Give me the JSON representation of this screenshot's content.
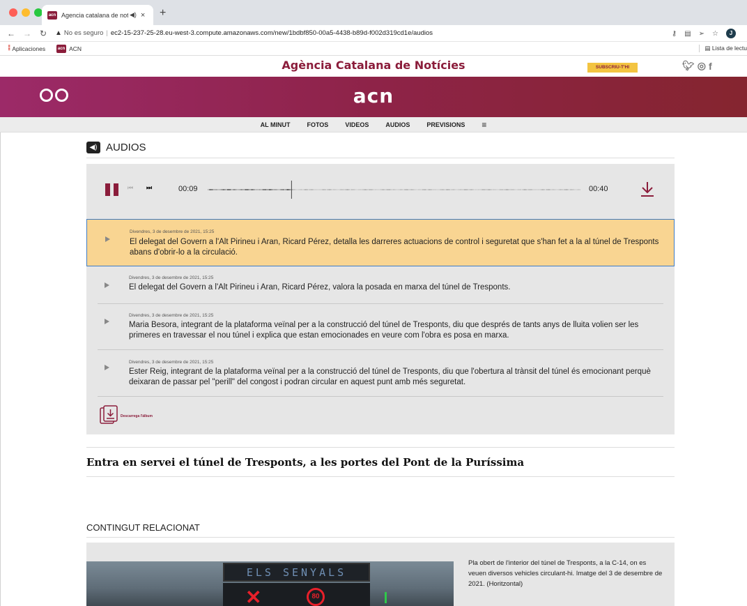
{
  "browser": {
    "tab_title": "Agencia catalana de notícies",
    "tab_favicon": "acn",
    "address_security": "No es seguro",
    "address_separator": "|",
    "address_url": "ec2-15-237-25-28.eu-west-3.compute.amazonaws.com/new/1bdbf850-00a5-4438-b89d-f002d319cd1e/audios",
    "profile_initial": "J",
    "bookmarks": [
      "Aplicaciones",
      "ACN"
    ],
    "reading_list": "Lista de lectu"
  },
  "site": {
    "name": "Agència Catalana de Notícies",
    "subscribe_label": "SUBSCRIU-T'HI",
    "logo": "acn",
    "social_icons": [
      "twitter-icon",
      "instagram-icon",
      "facebook-icon"
    ],
    "brand_color": "#8b1d3b",
    "accent_color": "#f3c441"
  },
  "menu": {
    "items": [
      "AL MINUT",
      "FOTOS",
      "VIDEOS",
      "AUDIOS",
      "PREVISIONS"
    ],
    "burger": "≡"
  },
  "audios": {
    "section_title": "AUDIOS",
    "player": {
      "current_time": "00:09",
      "total_time": "00:40",
      "progress_fraction": 0.225,
      "state": "playing"
    },
    "items": [
      {
        "date": "Divendres, 3 de desembre de 2021, 15:25",
        "text": "El delegat del Govern a l'Alt Pirineu i Aran, Ricard Pérez, detalla les darreres actuacions de control i seguretat que s'han fet a la al túnel de Tresponts abans d'obrir-lo a la circulació.",
        "active": true
      },
      {
        "date": "Divendres, 3 de desembre de 2021, 15:25",
        "text": "El delegat del Govern a l'Alt Pirineu i Aran, Ricard Pérez, valora la posada en marxa del túnel de Tresponts.",
        "active": false
      },
      {
        "date": "Divendres, 3 de desembre de 2021, 15:25",
        "text": "Maria Besora, integrant de la plataforma veïnal per a la construcció del túnel de Tresponts, diu que després de tants anys de lluita volien ser les primeres en travessar el nou túnel i explica que estan emocionades en veure com l'obra es posa en marxa.",
        "active": false
      },
      {
        "date": "Divendres, 3 de desembre de 2021, 15:25",
        "text": "Ester Reig, integrant de la plataforma veïnal per a la construcció del túnel de Tresponts, diu que l'obertura al trànsit del túnel és emocionant perquè deixaran de passar pel \"perill\" del congost i podran circular en aquest punt amb més seguretat.",
        "active": false
      }
    ],
    "download_album_label": "Descarrega l'àlbum"
  },
  "article": {
    "title": "Entra en servei el túnel de Tresponts, a les portes del Pont de la Puríssima"
  },
  "related": {
    "title": "CONTINGUT RELACIONAT",
    "photo_sign_text": "ELS SENYALS",
    "photo_speed_text": "80",
    "caption": "Pla obert de l'interior del túnel de Tresponts, a la C-14, on es veuen diversos vehicles circulant-hi. Imatge del 3 de desembre de 2021. (Horitzontal)"
  }
}
